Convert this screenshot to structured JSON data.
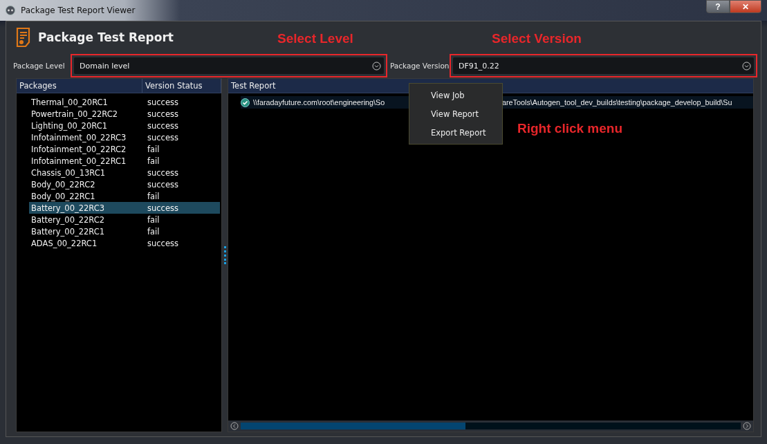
{
  "window": {
    "title": "Package Test Report Viewer",
    "buttons": [
      "?",
      "✕"
    ]
  },
  "header": {
    "title": "Package Test Report"
  },
  "annotations": [
    {
      "text": "Select Level"
    },
    {
      "text": "Select Version"
    },
    {
      "text": "Right click menu"
    }
  ],
  "package_level": {
    "label": "Package Level",
    "value": "Domain level"
  },
  "package_version": {
    "label": "Package Version",
    "value": "DF91_0.22"
  },
  "packages_table": {
    "columns": [
      "Packages",
      "Version Status"
    ],
    "rows": [
      {
        "name": "Thermal_00_20RC1",
        "status": "success",
        "selected": false
      },
      {
        "name": "Powertrain_00_22RC2",
        "status": "success",
        "selected": false
      },
      {
        "name": "Lighting_00_20RC1",
        "status": "success",
        "selected": false
      },
      {
        "name": "Infotainment_00_22RC3",
        "status": "success",
        "selected": false
      },
      {
        "name": "Infotainment_00_22RC2",
        "status": "fail",
        "selected": false
      },
      {
        "name": "Infotainment_00_22RC1",
        "status": "fail",
        "selected": false
      },
      {
        "name": "Chassis_00_13RC1",
        "status": "success",
        "selected": false
      },
      {
        "name": "Body_00_22RC2",
        "status": "success",
        "selected": false
      },
      {
        "name": "Body_00_22RC1",
        "status": "fail",
        "selected": false
      },
      {
        "name": "Battery_00_22RC3",
        "status": "success",
        "selected": true
      },
      {
        "name": "Battery_00_22RC2",
        "status": "fail",
        "selected": false
      },
      {
        "name": "Battery_00_22RC1",
        "status": "fail",
        "selected": false
      },
      {
        "name": "ADAS_00_22RC1",
        "status": "success",
        "selected": false
      }
    ]
  },
  "report_tree": {
    "column": "Test Report",
    "rows": [
      {
        "text_before_menu": "\\\\faradayfuture.com\\root\\engineering\\So",
        "text_after_menu": "areTools\\Autogen_tool_dev_builds\\testing\\package_develop_build\\Su",
        "checked": true
      }
    ]
  },
  "context_menu": {
    "items": [
      "View Job",
      "View Report",
      "Export Report"
    ]
  }
}
